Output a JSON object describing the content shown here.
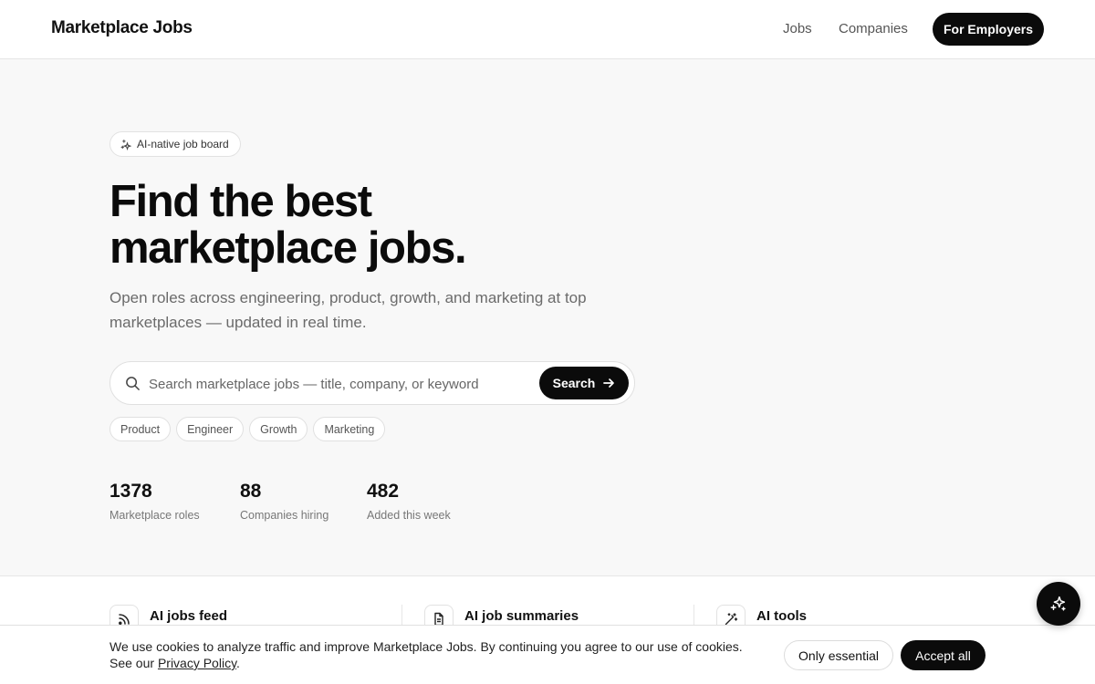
{
  "header": {
    "logo": "Marketplace Jobs",
    "nav": {
      "jobs": "Jobs",
      "companies": "Companies"
    },
    "cta": "For Employers"
  },
  "hero": {
    "badge": "AI-native job board",
    "headline_line1": "Find the best",
    "headline_line2": "marketplace jobs.",
    "subtitle": "Open roles across engineering, product, growth, and marketing at top marketplaces — updated in real time."
  },
  "search": {
    "placeholder": "Search marketplace jobs — title, company, or keyword",
    "value": "",
    "button": "Search",
    "icon": "search-icon",
    "button_icon": "arrow-right-icon"
  },
  "chips": [
    "Product",
    "Engineer",
    "Growth",
    "Marketing"
  ],
  "stats": [
    {
      "value": "1378",
      "label": "Marketplace roles"
    },
    {
      "value": "88",
      "label": "Companies hiring"
    },
    {
      "value": "482",
      "label": "Added this week"
    }
  ],
  "features": [
    {
      "title": "AI jobs feed",
      "icon": "rss-icon"
    },
    {
      "title": "AI job summaries",
      "icon": "document-icon"
    },
    {
      "title": "AI tools",
      "icon": "magic-wand-icon"
    }
  ],
  "cookie": {
    "text": "We use cookies to analyze traffic and improve Marketplace Jobs. By continuing you agree to our use of cookies. See our",
    "link": "Privacy Policy",
    "end": ".",
    "essential": "Only essential",
    "accept": "Accept all"
  },
  "fab": {
    "icon": "sparkles-icon"
  },
  "colors": {
    "primary": "#0b0b0b",
    "background": "#f8f8f8",
    "muted_text": "#6b6b6b",
    "border": "#e0e0e0"
  }
}
